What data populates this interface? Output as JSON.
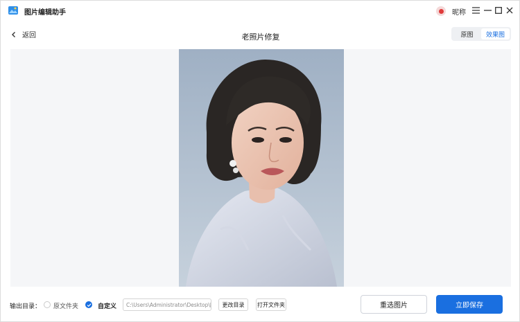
{
  "app": {
    "title": "图片编辑助手",
    "user_name": "昵称",
    "accent_color": "#1a6fe0"
  },
  "icons": {
    "logo": "app-logo-icon",
    "avatar": "user-avatar-icon",
    "menu": "hamburger-menu-icon",
    "minimize": "minimize-icon",
    "maximize": "maximize-icon",
    "close": "close-icon",
    "back": "chevron-left-icon",
    "check": "check-icon"
  },
  "nav": {
    "back_label": "返回",
    "page_title": "老照片修复",
    "view_options": [
      "原图",
      "效果图"
    ],
    "active_view": "效果图"
  },
  "output": {
    "label": "输出目录：",
    "option_original": "原文件夹",
    "option_custom": "自定义",
    "selected": "自定义",
    "path_value": "C:\\Users\\Administrator\\Desktop\\图",
    "change_dir_label": "更改目录",
    "open_folder_label": "打开文件夹"
  },
  "actions": {
    "reselect_label": "重选图片",
    "save_label": "立即保存"
  }
}
